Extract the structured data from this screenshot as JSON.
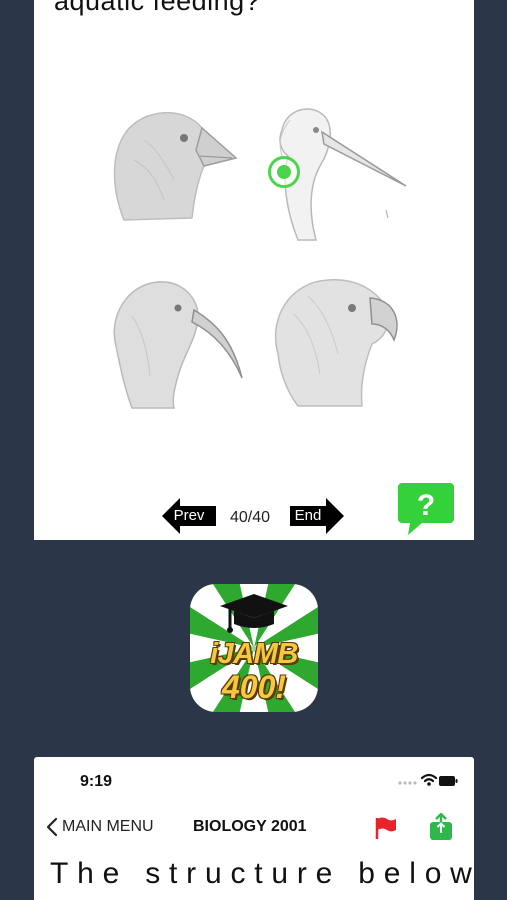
{
  "top_card": {
    "question_tail": "aquatic feeding?",
    "counter": "40/40",
    "prev_label": "Prev",
    "end_label": "End",
    "help_icon": "question-bubble-icon",
    "options": [
      {
        "name": "bird-option-a",
        "description_icon": "crow-head-icon"
      },
      {
        "name": "bird-option-b",
        "description_icon": "heron-head-icon"
      },
      {
        "name": "bird-option-c",
        "description_icon": "curlew-head-icon"
      },
      {
        "name": "bird-option-d",
        "description_icon": "parrot-head-icon"
      }
    ],
    "selected_option": "bird-option-b",
    "accent_color": "#4cd44c"
  },
  "app_icon": {
    "line1": "iJAMB",
    "line2": "400!"
  },
  "bottom_card": {
    "status_time": "9:19",
    "back_label": "MAIN MENU",
    "title": "BIOLOGY 2001",
    "question_head": "The structure below",
    "flag_color": "#e8232a",
    "share_color": "#2fb84a"
  }
}
